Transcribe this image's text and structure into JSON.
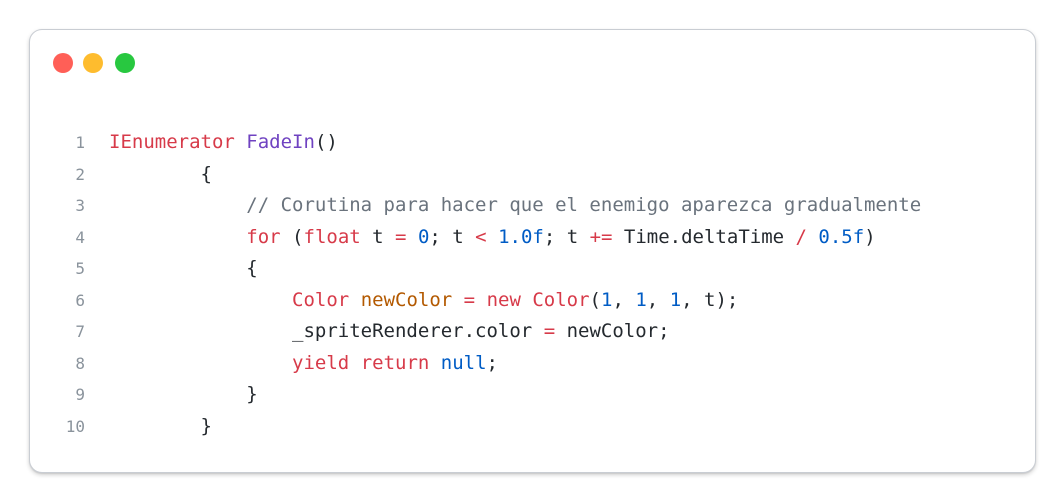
{
  "window": {
    "controls": [
      {
        "name": "close",
        "color": "#ff5f57"
      },
      {
        "name": "minimize",
        "color": "#febc2e"
      },
      {
        "name": "zoom",
        "color": "#28c840"
      }
    ]
  },
  "code": {
    "language": "C#",
    "lines": [
      {
        "n": "1",
        "tokens": [
          {
            "t": "IEnumerator",
            "c": "kw"
          },
          {
            "t": " ",
            "c": ""
          },
          {
            "t": "FadeIn",
            "c": "fn"
          },
          {
            "t": "()",
            "c": ""
          }
        ]
      },
      {
        "n": "2",
        "tokens": [
          {
            "t": "        {",
            "c": ""
          }
        ]
      },
      {
        "n": "3",
        "tokens": [
          {
            "t": "            // Corutina para hacer que el enemigo aparezca gradualmente",
            "c": "cmt"
          }
        ]
      },
      {
        "n": "4",
        "tokens": [
          {
            "t": "            ",
            "c": ""
          },
          {
            "t": "for",
            "c": "kw"
          },
          {
            "t": " (",
            "c": ""
          },
          {
            "t": "float",
            "c": "kw"
          },
          {
            "t": " t ",
            "c": ""
          },
          {
            "t": "=",
            "c": "kw"
          },
          {
            "t": " ",
            "c": ""
          },
          {
            "t": "0",
            "c": "num"
          },
          {
            "t": "; t ",
            "c": ""
          },
          {
            "t": "<",
            "c": "kw"
          },
          {
            "t": " ",
            "c": ""
          },
          {
            "t": "1.0f",
            "c": "num"
          },
          {
            "t": "; t ",
            "c": ""
          },
          {
            "t": "+=",
            "c": "kw"
          },
          {
            "t": " Time.deltaTime ",
            "c": ""
          },
          {
            "t": "/",
            "c": "kw"
          },
          {
            "t": " ",
            "c": ""
          },
          {
            "t": "0.5f",
            "c": "num"
          },
          {
            "t": ")",
            "c": ""
          }
        ]
      },
      {
        "n": "5",
        "tokens": [
          {
            "t": "            {",
            "c": ""
          }
        ]
      },
      {
        "n": "6",
        "tokens": [
          {
            "t": "                ",
            "c": ""
          },
          {
            "t": "Color",
            "c": "kw"
          },
          {
            "t": " ",
            "c": ""
          },
          {
            "t": "newColor",
            "c": "var"
          },
          {
            "t": " ",
            "c": ""
          },
          {
            "t": "=",
            "c": "kw"
          },
          {
            "t": " ",
            "c": ""
          },
          {
            "t": "new",
            "c": "kw"
          },
          {
            "t": " ",
            "c": ""
          },
          {
            "t": "Color",
            "c": "kw"
          },
          {
            "t": "(",
            "c": ""
          },
          {
            "t": "1",
            "c": "num"
          },
          {
            "t": ", ",
            "c": ""
          },
          {
            "t": "1",
            "c": "num"
          },
          {
            "t": ", ",
            "c": ""
          },
          {
            "t": "1",
            "c": "num"
          },
          {
            "t": ", t);",
            "c": ""
          }
        ]
      },
      {
        "n": "7",
        "tokens": [
          {
            "t": "                _spriteRenderer.color ",
            "c": ""
          },
          {
            "t": "=",
            "c": "kw"
          },
          {
            "t": " newColor;",
            "c": ""
          }
        ]
      },
      {
        "n": "8",
        "tokens": [
          {
            "t": "                ",
            "c": ""
          },
          {
            "t": "yield",
            "c": "kw"
          },
          {
            "t": " ",
            "c": ""
          },
          {
            "t": "return",
            "c": "kw"
          },
          {
            "t": " ",
            "c": ""
          },
          {
            "t": "null",
            "c": "num"
          },
          {
            "t": ";",
            "c": ""
          }
        ]
      },
      {
        "n": "9",
        "tokens": [
          {
            "t": "            }",
            "c": ""
          }
        ]
      },
      {
        "n": "10",
        "tokens": [
          {
            "t": "        }",
            "c": ""
          }
        ]
      }
    ]
  }
}
